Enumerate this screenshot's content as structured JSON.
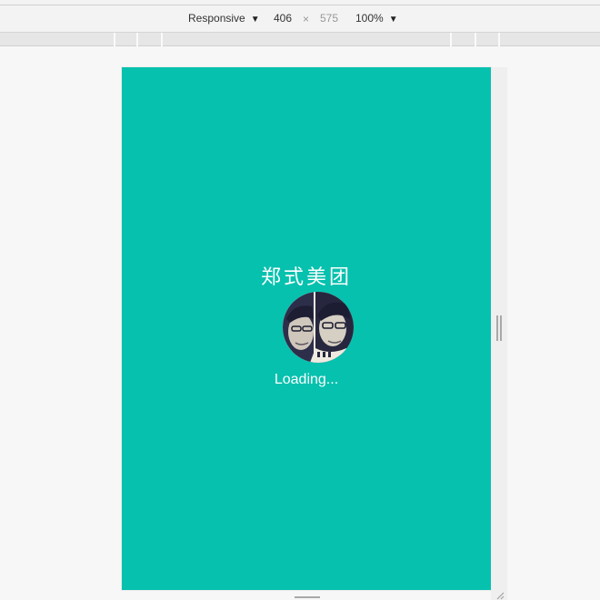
{
  "toolbar": {
    "mode_label": "Responsive",
    "width_value": "406",
    "times_symbol": "×",
    "height_value": "575",
    "zoom_label": "100%",
    "caret_symbol": "▼"
  },
  "app": {
    "title": "郑式美团",
    "loading_text": "Loading...",
    "background_color": "#06c1ae"
  },
  "icons": {
    "avatar": "avatar-photo",
    "side_resize": "vertical-resize-handle",
    "bottom_resize": "horizontal-resize-handle",
    "corner_resize": "corner-resize-handle"
  }
}
